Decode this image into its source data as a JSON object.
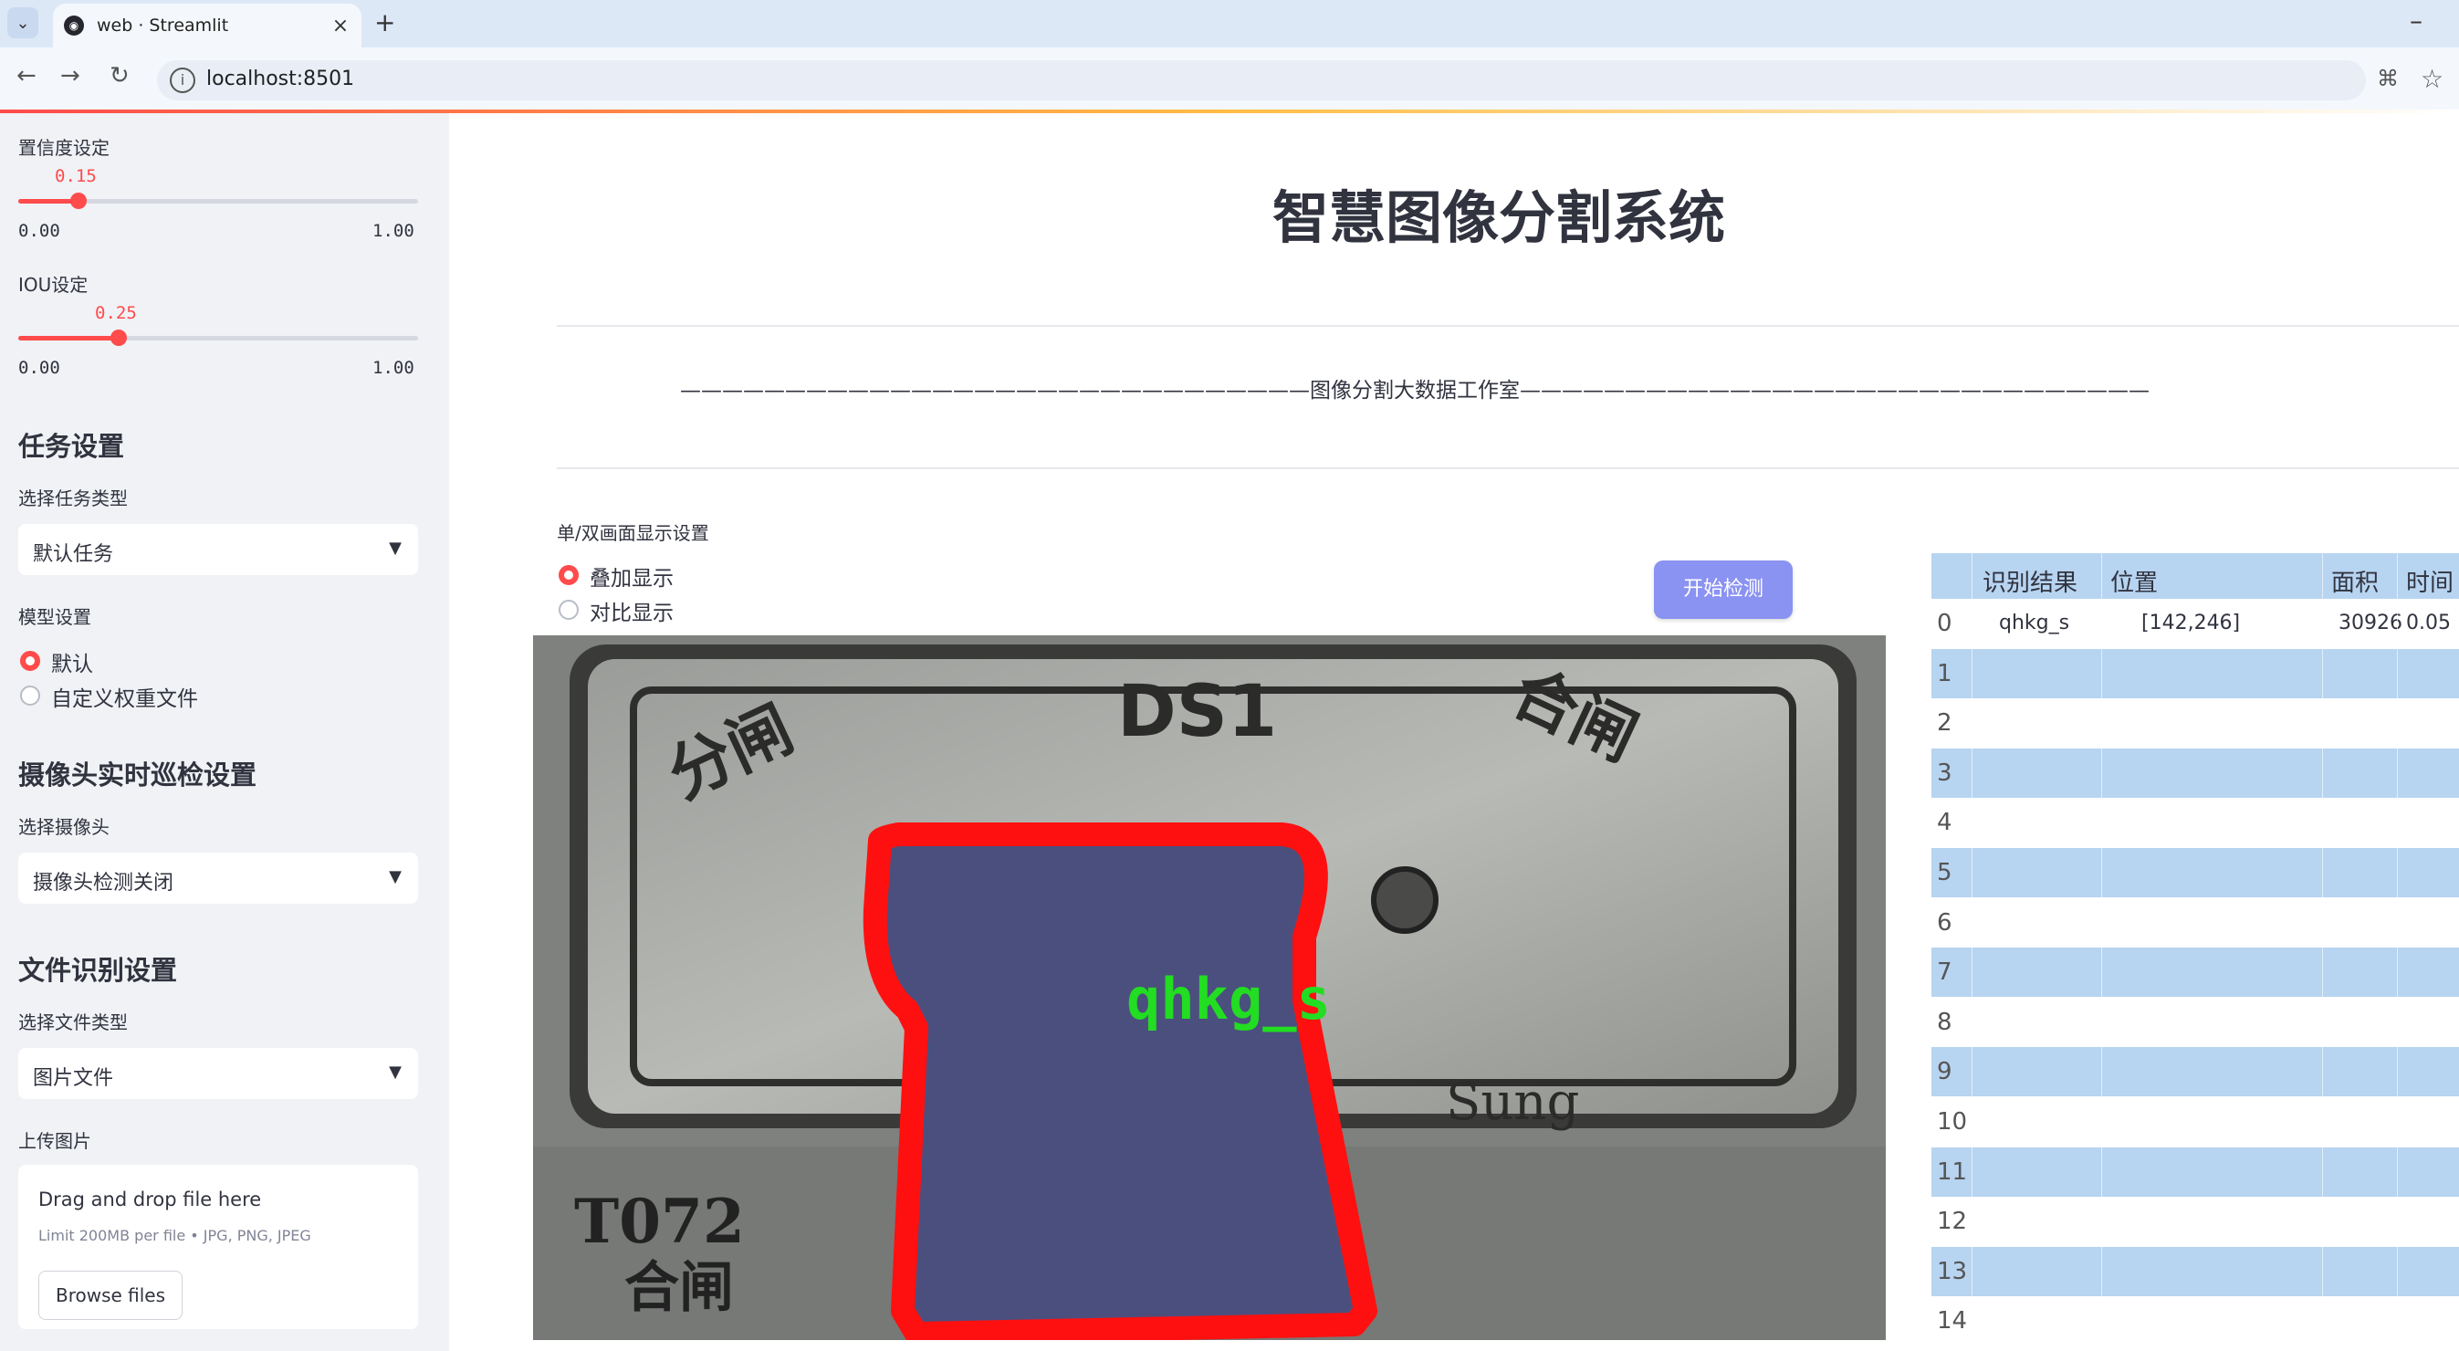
{
  "browser": {
    "tab_title": "web · Streamlit",
    "url": "localhost:8501"
  },
  "sidebar": {
    "confidence": {
      "label": "置信度设定",
      "value": "0.15",
      "min": "0.00",
      "max": "1.00",
      "fraction": 0.15
    },
    "iou": {
      "label": "IOU设定",
      "value": "0.25",
      "min": "0.00",
      "max": "1.00",
      "fraction": 0.25
    },
    "task_settings": {
      "heading": "任务设置",
      "task_type_label": "选择任务类型",
      "task_type_value": "默认任务",
      "model_label": "模型设置",
      "model_options": [
        "默认",
        "自定义权重文件"
      ],
      "model_selected": 0
    },
    "camera_settings": {
      "heading": "摄像头实时巡检设置",
      "camera_label": "选择摄像头",
      "camera_value": "摄像头检测关闭"
    },
    "file_settings": {
      "heading": "文件识别设置",
      "file_type_label": "选择文件类型",
      "file_type_value": "图片文件",
      "upload_label": "上传图片",
      "drop_title": "Drag and drop file here",
      "drop_limit": "Limit 200MB per file • JPG, PNG, JPEG",
      "browse_label": "Browse files"
    }
  },
  "main": {
    "title": "智慧图像分割系统",
    "banner": "——————————————————————————————图像分割大数据工作室——————————————————————————————",
    "display_label": "单/双画面显示设置",
    "display_options": [
      "叠加显示",
      "对比显示"
    ],
    "display_selected": 0,
    "start_button": "开始检测",
    "image": {
      "overlay_label": "qhkg_s",
      "plate_text_top": "DS1",
      "plate_text_left": "分闸",
      "plate_text_right": "合闸",
      "plate_text_bottom": "Sung",
      "plate_text_code": "T072",
      "plate_text_lower": "合闸"
    }
  },
  "table": {
    "columns": [
      "识别结果",
      "位置",
      "面积",
      "时间"
    ],
    "rows": [
      {
        "index": "0",
        "result": "qhkg_s",
        "position": "[142,246]",
        "area": "30926",
        "time": "0.05"
      },
      {
        "index": "1"
      },
      {
        "index": "2"
      },
      {
        "index": "3"
      },
      {
        "index": "4"
      },
      {
        "index": "5"
      },
      {
        "index": "6"
      },
      {
        "index": "7"
      },
      {
        "index": "8"
      },
      {
        "index": "9"
      },
      {
        "index": "10"
      },
      {
        "index": "11"
      },
      {
        "index": "12"
      },
      {
        "index": "13"
      },
      {
        "index": "14"
      }
    ]
  },
  "colors": {
    "accent": "#ff4b4b",
    "button": "#8a92f2",
    "table_stripe": "#b7d4f1",
    "sidebar_bg": "#f0f2f6",
    "mask_fill": "#4b4f7e",
    "mask_outline": "#ff1010",
    "label_green": "#22dd22"
  }
}
